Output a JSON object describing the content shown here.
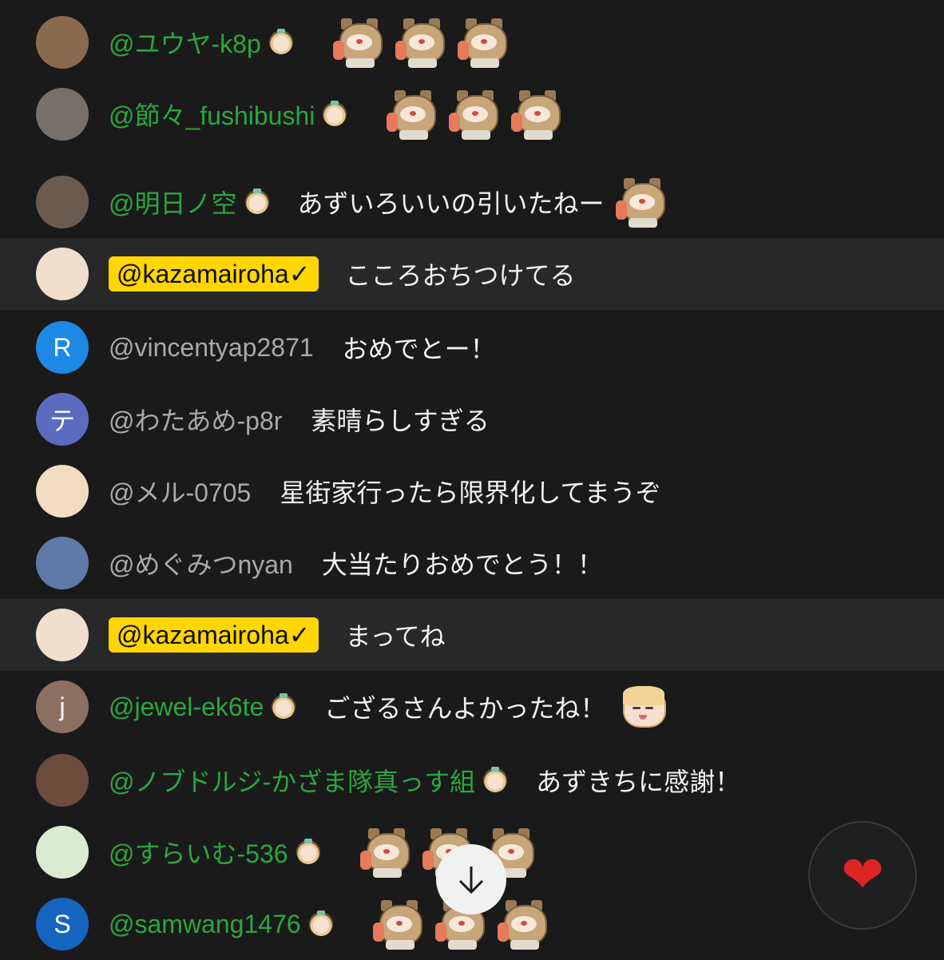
{
  "chat": {
    "messages": [
      {
        "author": "@ユウヤ-k8p",
        "author_style": "member",
        "avatar_text": "",
        "avatar_color": "#8a6a4f",
        "message": "",
        "emojis": [
          "tanuki-emoji",
          "tanuki-emoji",
          "tanuki-emoji"
        ]
      },
      {
        "author": "@節々_fushibushi",
        "author_style": "member",
        "avatar_text": "",
        "avatar_color": "#77706a",
        "message": "",
        "emojis": [
          "tanuki-emoji",
          "tanuki-emoji",
          "tanuki-emoji"
        ]
      },
      {
        "author": "@明日ノ空",
        "author_style": "member",
        "avatar_text": "",
        "avatar_color": "#6b5b4f",
        "message": "あずいろいいの引いたねー",
        "emojis": [
          "tanuki-emoji"
        ]
      },
      {
        "author": "@kazamairoha✓",
        "author_style": "owner",
        "avatar_text": "",
        "avatar_color": "#f0dfcf",
        "message": "こころおちつけてる",
        "emojis": []
      },
      {
        "author": "@vincentyap2871",
        "author_style": "plain",
        "avatar_text": "R",
        "avatar_color": "#1e88e5",
        "message": "おめでとー！",
        "emojis": []
      },
      {
        "author": "@わたあめ-p8r",
        "author_style": "plain",
        "avatar_text": "テ",
        "avatar_color": "#5c6bc0",
        "message": "素晴らしすぎる",
        "emojis": []
      },
      {
        "author": "@メル-0705",
        "author_style": "plain",
        "avatar_text": "",
        "avatar_color": "#f2dcc0",
        "message": "星街家行ったら限界化してまうぞ",
        "emojis": []
      },
      {
        "author": "@めぐみつnyan",
        "author_style": "plain",
        "avatar_text": "",
        "avatar_color": "#5f79a8",
        "message": "大当たりおめでとう！！",
        "emojis": []
      },
      {
        "author": "@kazamairoha✓",
        "author_style": "owner",
        "avatar_text": "",
        "avatar_color": "#f0dfcf",
        "message": "まってね",
        "emojis": []
      },
      {
        "author": "@jewel-ek6te",
        "author_style": "member",
        "avatar_text": "j",
        "avatar_color": "#8d6e63",
        "message": "ござるさんよかったね！",
        "emojis": [
          "iroha-emoji"
        ]
      },
      {
        "author": "@ノブドルジ-かざま隊真っす組",
        "author_style": "member",
        "avatar_text": "",
        "avatar_color": "#6d4c3d",
        "message": "あずきちに感謝！",
        "emojis": []
      },
      {
        "author": "@すらいむ-536",
        "author_style": "member",
        "avatar_text": "",
        "avatar_color": "#d9ecd2",
        "message": "",
        "emojis": [
          "tanuki-emoji",
          "tanuki-emoji",
          "tanuki-emoji"
        ]
      },
      {
        "author": "@samwang1476",
        "author_style": "member",
        "avatar_text": "S",
        "avatar_color": "#1565c0",
        "message": "",
        "emojis": [
          "tanuki-emoji",
          "tanuki-emoji",
          "tanuki-emoji"
        ]
      }
    ]
  },
  "controls": {
    "scroll_down_icon": "arrow-down-icon",
    "heart_icon": "heart-icon",
    "heart_glyph": "❤",
    "heart_color": "#e02424"
  },
  "colors": {
    "background": "#1a1a1a",
    "member_name": "#2ba640",
    "plain_name": "#aaaaaa",
    "owner_badge": "#ffd600",
    "host_row": "#282828"
  }
}
